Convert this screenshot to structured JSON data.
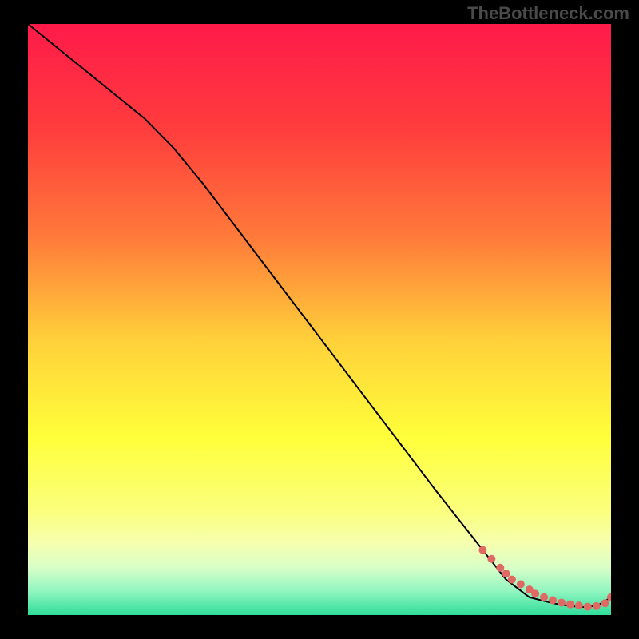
{
  "watermark": "TheBottleneck.com",
  "chart_data": {
    "type": "line",
    "title": "",
    "xlabel": "",
    "ylabel": "",
    "xlim": [
      0,
      100
    ],
    "ylim": [
      0,
      100
    ],
    "gradient_stops": [
      {
        "offset": 0,
        "color": "#ff1a4a"
      },
      {
        "offset": 18,
        "color": "#ff3d3d"
      },
      {
        "offset": 36,
        "color": "#ff7a3a"
      },
      {
        "offset": 54,
        "color": "#ffd23a"
      },
      {
        "offset": 70,
        "color": "#ffff3a"
      },
      {
        "offset": 82,
        "color": "#fbff7a"
      },
      {
        "offset": 88,
        "color": "#f5ffb0"
      },
      {
        "offset": 92,
        "color": "#d8ffc8"
      },
      {
        "offset": 96,
        "color": "#90f5c0"
      },
      {
        "offset": 100,
        "color": "#2fdd9a"
      }
    ],
    "series": [
      {
        "name": "bottleneck-curve",
        "x": [
          0,
          10,
          20,
          25,
          30,
          40,
          50,
          60,
          70,
          78,
          82,
          86,
          90,
          93,
          96,
          98,
          100
        ],
        "y": [
          100,
          92,
          84,
          79,
          73,
          60,
          47,
          34,
          21,
          11,
          6,
          3,
          2,
          1.5,
          1.3,
          1.8,
          3
        ]
      }
    ],
    "scatter": {
      "name": "sample-points",
      "color": "#e06a63",
      "x": [
        78,
        79.5,
        81,
        82,
        83,
        84.5,
        86,
        87,
        88.5,
        90,
        91.5,
        93,
        94.5,
        96,
        97.5,
        99,
        100
      ],
      "y": [
        11,
        9.5,
        8,
        7,
        6,
        5.2,
        4.3,
        3.6,
        3.0,
        2.5,
        2.1,
        1.8,
        1.6,
        1.4,
        1.5,
        2.0,
        3.0
      ]
    }
  }
}
